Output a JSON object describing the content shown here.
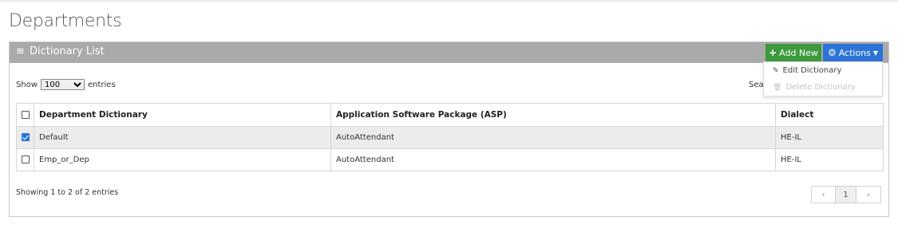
{
  "page": {
    "title": "Departments"
  },
  "panel": {
    "title": "Dictionary List",
    "add_button": "Add New",
    "actions_button": "Actions"
  },
  "length": {
    "prefix": "Show",
    "selected": "100",
    "suffix": "entries"
  },
  "search": {
    "label": "Sea"
  },
  "table": {
    "headers": [
      "Department Dictionary",
      "Application Software Package (ASP)",
      "Dialect"
    ],
    "rows": [
      {
        "checked": true,
        "dictionary": "Default",
        "asp": "AutoAttendant",
        "dialect": "HE-IL"
      },
      {
        "checked": false,
        "dictionary": "Emp_or_Dep",
        "asp": "AutoAttendant",
        "dialect": "HE-IL"
      }
    ]
  },
  "info": "Showing 1 to 2 of 2 entries",
  "pagination": {
    "prev": "‹",
    "current": "1",
    "next": "›"
  },
  "actions_menu": {
    "items": [
      {
        "label": "Edit Dictionary",
        "icon": "pencil-icon",
        "enabled": true
      },
      {
        "label": "Delete Dictionary",
        "icon": "trash-icon",
        "enabled": false
      }
    ]
  },
  "colors": {
    "header_bar": "#aaaaaa",
    "add_button": "#3c9a3c",
    "actions_button": "#2c73d8"
  }
}
